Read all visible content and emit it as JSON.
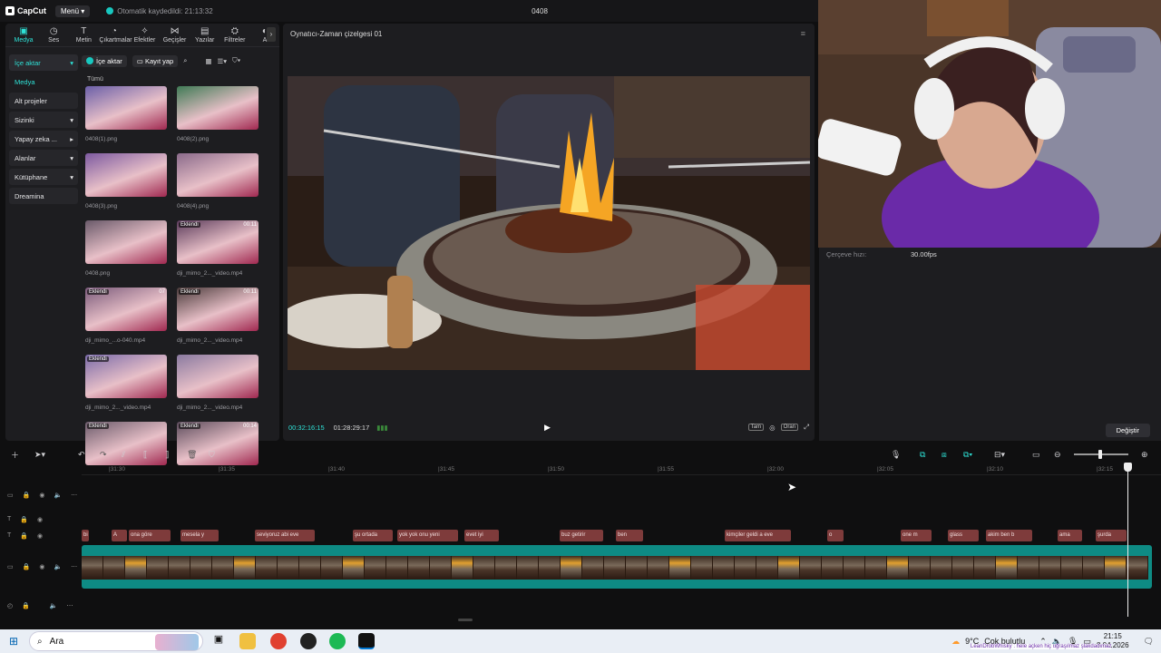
{
  "app": {
    "logo_text": "CapCut",
    "menu_label": "Menü",
    "autosave_text": "Otomatik kaydedildi: 21:13:32",
    "project_title": "0408"
  },
  "toolbar": {
    "items": [
      {
        "label": "Medya",
        "icon": "media-icon",
        "active": true
      },
      {
        "label": "Ses",
        "icon": "audio-icon",
        "active": false
      },
      {
        "label": "Metin",
        "icon": "text-icon",
        "active": false
      },
      {
        "label": "Çıkartmalar",
        "icon": "sticker-icon",
        "active": false
      },
      {
        "label": "Efektler",
        "icon": "effects-icon",
        "active": false
      },
      {
        "label": "Geçişler",
        "icon": "transition-icon",
        "active": false
      },
      {
        "label": "Yazılar",
        "icon": "captions-icon",
        "active": false
      },
      {
        "label": "Filtreler",
        "icon": "filter-icon",
        "active": false
      },
      {
        "label": "A",
        "icon": "adjust-icon",
        "active": false
      }
    ]
  },
  "sidenav": {
    "items": [
      {
        "label": "İçe aktar",
        "style": "sel",
        "arrow": "▾"
      },
      {
        "label": "Medya",
        "style": "sub",
        "arrow": ""
      },
      {
        "label": "Alt projeler",
        "style": "plain",
        "arrow": ""
      },
      {
        "label": "Sizinki",
        "style": "plain",
        "arrow": "▾"
      },
      {
        "label": "Yapay zeka ...",
        "style": "plain",
        "arrow": "▸"
      },
      {
        "label": "Alanlar",
        "style": "plain",
        "arrow": "▾"
      },
      {
        "label": "Kütüphane",
        "style": "plain",
        "arrow": "▾"
      },
      {
        "label": "Dreamina",
        "style": "plain",
        "arrow": ""
      }
    ]
  },
  "media": {
    "import_label": "İçe aktar",
    "record_label": "Kayıt yap",
    "all_label": "Tümü",
    "items": [
      {
        "caption": "0408(1).png",
        "badge": "",
        "duration": "",
        "tone": "#6b5fa8"
      },
      {
        "caption": "0408(2).png",
        "badge": "",
        "duration": "",
        "tone": "#3f7a55"
      },
      {
        "caption": "0408(3).png",
        "badge": "",
        "duration": "",
        "tone": "#7d5aa0"
      },
      {
        "caption": "0408(4).png",
        "badge": "",
        "duration": "",
        "tone": "#8a6a8a"
      },
      {
        "caption": "0408.png",
        "badge": "",
        "duration": "",
        "tone": "#6a5a6a"
      },
      {
        "caption": "dji_mimo_2..._video.mp4",
        "badge": "Eklendi",
        "duration": "00:11",
        "tone": "#5a3a5a"
      },
      {
        "caption": "dji_mimo_...o-040.mp4",
        "badge": "Eklendi",
        "duration": "07",
        "tone": "#7a5a7a"
      },
      {
        "caption": "dji_mimo_2..._video.mp4",
        "badge": "Eklendi",
        "duration": "00:11",
        "tone": "#4a3a3a"
      },
      {
        "caption": "dji_mimo_2..._video.mp4",
        "badge": "Eklendi",
        "duration": "",
        "tone": "#7a6aa8"
      },
      {
        "caption": "dji_mimo_2..._video.mp4",
        "badge": "",
        "duration": "",
        "tone": "#8a7aa0"
      },
      {
        "caption": "",
        "badge": "Eklendi",
        "duration": "",
        "tone": "#6a5a6a"
      },
      {
        "caption": "",
        "badge": "Eklendi",
        "duration": "00:14",
        "tone": "#5a4a5a"
      }
    ]
  },
  "player": {
    "title": "Oynatıcı-Zaman çizelgesi 01",
    "current_time": "00:32:16:15",
    "total_time": "01:28:29:17",
    "full_label": "Tam",
    "ratio_label": "Oran"
  },
  "inspector": {
    "frame_rate_label": "Çerçeve hızı:",
    "frame_rate_value": "30.00fps",
    "change_button": "Değiştir"
  },
  "timeline": {
    "ruler_ticks": [
      "|31:30",
      "|31:35",
      "|31:40",
      "|31:45",
      "|31:50",
      "|31:55",
      "|32:00",
      "|32:05",
      "|32:10",
      "|32:15"
    ],
    "text_clips": [
      {
        "label": "bi"
      },
      {
        "label": "A"
      },
      {
        "label": "ona göre"
      },
      {
        "label": "mesela y"
      },
      {
        "label": "seviyoruz abi eve"
      },
      {
        "label": "şu ortada"
      },
      {
        "label": "yok yok onu yeni"
      },
      {
        "label": "evet iyi"
      },
      {
        "label": "buz getirir"
      },
      {
        "label": "ben"
      },
      {
        "label": "kimçiler geldi a eve"
      },
      {
        "label": "o"
      },
      {
        "label": "one m"
      },
      {
        "label": "glass"
      },
      {
        "label": "akim ben b"
      },
      {
        "label": "ama"
      },
      {
        "label": "şurda"
      }
    ]
  },
  "taskbar": {
    "search_placeholder": "Ara",
    "weather_temp": "9°C",
    "weather_text": "Çok bulutlu",
    "clock_time": "21:15",
    "clock_date": "8.04.2026",
    "ticker": "LeanDrobWhisky : hele açken hiç uğraşılmaz şlakdadımaz"
  }
}
